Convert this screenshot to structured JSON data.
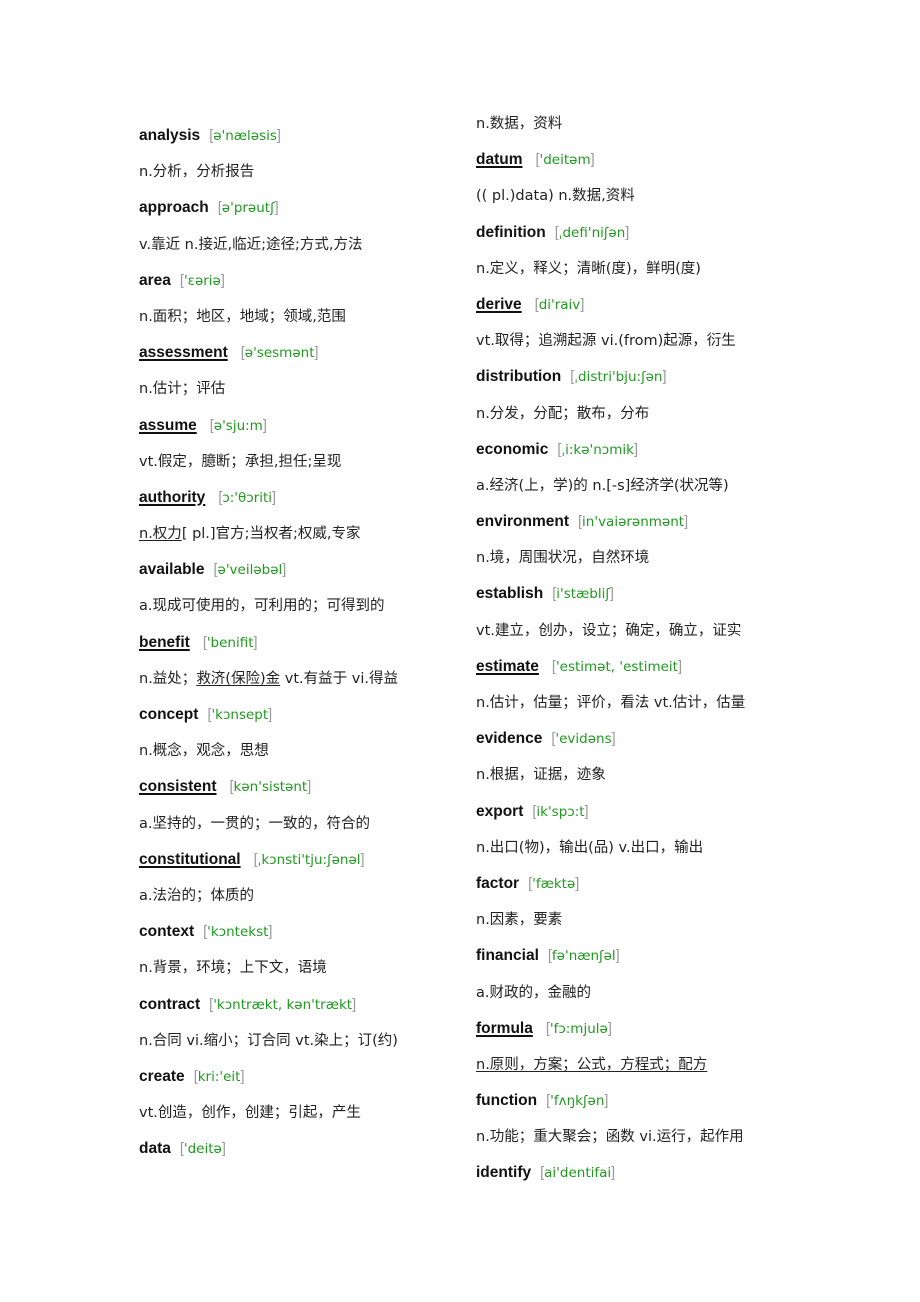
{
  "left_column": [
    {
      "word": "analysis",
      "underlined": false,
      "phonetic": "ə'næləsis",
      "definition": "n.分析，分析报告"
    },
    {
      "word": "approach",
      "underlined": false,
      "phonetic": "ə'prəutʃ",
      "definition": "v.靠近  n.接近,临近;途径;方式,方法"
    },
    {
      "word": "area",
      "underlined": false,
      "phonetic": "'ɛəriə",
      "definition": "n.面积；地区，地域；领域,范围"
    },
    {
      "word": "assessment",
      "underlined": true,
      "phonetic": "ə'sesmənt",
      "definition": "n.估计；评估"
    },
    {
      "word": "assume",
      "underlined": true,
      "phonetic": "ə'sju:m",
      "definition": "vt.假定，臆断；承担,担任;呈现"
    },
    {
      "word": "authority",
      "underlined": true,
      "phonetic": "ɔ:'θɔriti",
      "definition_underlined": "n.权力",
      "definition": "[ pl.]官方;当权者;权威,专家"
    },
    {
      "word": "available",
      "underlined": false,
      "phonetic": "ə'veiləbəl",
      "definition": "a.现成可使用的，可利用的；可得到的"
    },
    {
      "word": "benefit",
      "underlined": true,
      "phonetic": "'benifit",
      "definition_pre": "n.益处；",
      "definition_underlined": "救济(保险)金",
      "definition": "  vt.有益于  vi.得益"
    },
    {
      "word": "concept",
      "underlined": false,
      "phonetic": "'kɔnsept",
      "definition": "n.概念，观念，思想"
    },
    {
      "word": "consistent",
      "underlined": true,
      "phonetic": "kən'sistənt",
      "definition": "a.坚持的，一贯的；一致的，符合的"
    },
    {
      "word": "constitutional",
      "underlined": true,
      "phonetic": "ˌkɔnsti'tju:ʃənəl",
      "definition": "a.法治的；体质的"
    },
    {
      "word": "context",
      "underlined": false,
      "phonetic": "'kɔntekst",
      "definition": "n.背景，环境；上下文，语境"
    },
    {
      "word": "contract",
      "underlined": false,
      "phonetic": "'kɔntrækt, kən'trækt",
      "definition": "n.合同  vi.缩小；订合同  vt.染上；订(约)"
    },
    {
      "word": "create",
      "underlined": false,
      "phonetic": "kri:'eit",
      "definition": "vt.创造，创作，创建；引起，产生"
    },
    {
      "word": "data",
      "underlined": false,
      "phonetic": "'deitə",
      "definition": ""
    }
  ],
  "right_column_lead": "n.数据，资料",
  "right_column": [
    {
      "word": "datum",
      "underlined": true,
      "phonetic": "'deitəm",
      "definition": "(( pl.)data) n.数据,资料"
    },
    {
      "word": "definition",
      "underlined": false,
      "phonetic": "ˌdefi'niʃən",
      "definition": "n.定义，释义；清晰(度)，鲜明(度)"
    },
    {
      "word": "derive",
      "underlined": true,
      "phonetic": "di'raiv",
      "definition": "vt.取得；追溯起源  vi.(from)起源，衍生"
    },
    {
      "word": "distribution",
      "underlined": false,
      "phonetic": "ˌdistri'bju:ʃən",
      "definition": "n.分发，分配；散布，分布"
    },
    {
      "word": "economic",
      "underlined": false,
      "phonetic": "ˌi:kə'nɔmik",
      "definition": "a.经济(上，学)的  n.[-s]经济学(状况等)"
    },
    {
      "word": "environment",
      "underlined": false,
      "phonetic": "in'vaiərənmənt",
      "definition": "n.境，周围状况，自然环境"
    },
    {
      "word": "establish",
      "underlined": false,
      "phonetic": "i'stæbliʃ",
      "definition": "vt.建立，创办，设立；确定，确立，证实"
    },
    {
      "word": "estimate",
      "underlined": true,
      "phonetic": "'estimət,  'estimeit",
      "definition": "n.估计，估量；评价，看法  vt.估计，估量"
    },
    {
      "word": "evidence",
      "underlined": false,
      "phonetic": "'evidəns",
      "definition": "n.根据，证据，迹象"
    },
    {
      "word": "export",
      "underlined": false,
      "phonetic": "ik'spɔ:t",
      "definition": "n.出口(物)，输出(品) v.出口，输出"
    },
    {
      "word": "factor",
      "underlined": false,
      "phonetic": "'fæktə",
      "definition": "n.因素，要素"
    },
    {
      "word": "financial",
      "underlined": false,
      "phonetic": "fə'nænʃəl",
      "definition": "a.财政的，金融的"
    },
    {
      "word": "formula",
      "underlined": true,
      "phonetic": "'fɔ:mjulə",
      "definition_underlined": "n.原则，方案；公式，方程式；配方",
      "definition": ""
    },
    {
      "word": "function",
      "underlined": false,
      "phonetic": "'fʌŋkʃən",
      "definition": "n.功能；重大聚会；函数  vi.运行，起作用"
    },
    {
      "word": "identify",
      "underlined": false,
      "phonetic": "ai'dentifai",
      "definition": ""
    }
  ],
  "bracket_open": "[",
  "bracket_close": "]",
  "colors": {
    "phonetic": "#1f9a1f",
    "bracket": "#9a9a9a",
    "headword": "#111111"
  }
}
